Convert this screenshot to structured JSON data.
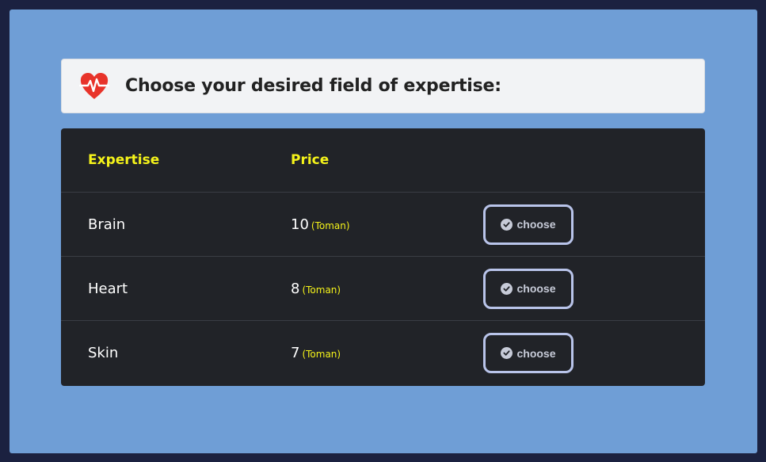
{
  "header": {
    "title": "Choose your desired field of expertise:",
    "icon": "heartbeat-icon"
  },
  "table": {
    "columns": [
      "Expertise",
      "Price"
    ],
    "rows": [
      {
        "expertise": "Brain",
        "price": "10",
        "unit": "(Toman)",
        "action": "choose"
      },
      {
        "expertise": "Heart",
        "price": "8",
        "unit": "(Toman)",
        "action": "choose"
      },
      {
        "expertise": "Skin",
        "price": "7",
        "unit": "(Toman)",
        "action": "choose"
      }
    ]
  },
  "colors": {
    "page_bg": "#1b2140",
    "panel_bg": "#6f9ed6",
    "table_bg": "#212328",
    "header_accent": "#f5f31a",
    "heart": "#e8332a",
    "button_border": "#b9c4ea"
  }
}
